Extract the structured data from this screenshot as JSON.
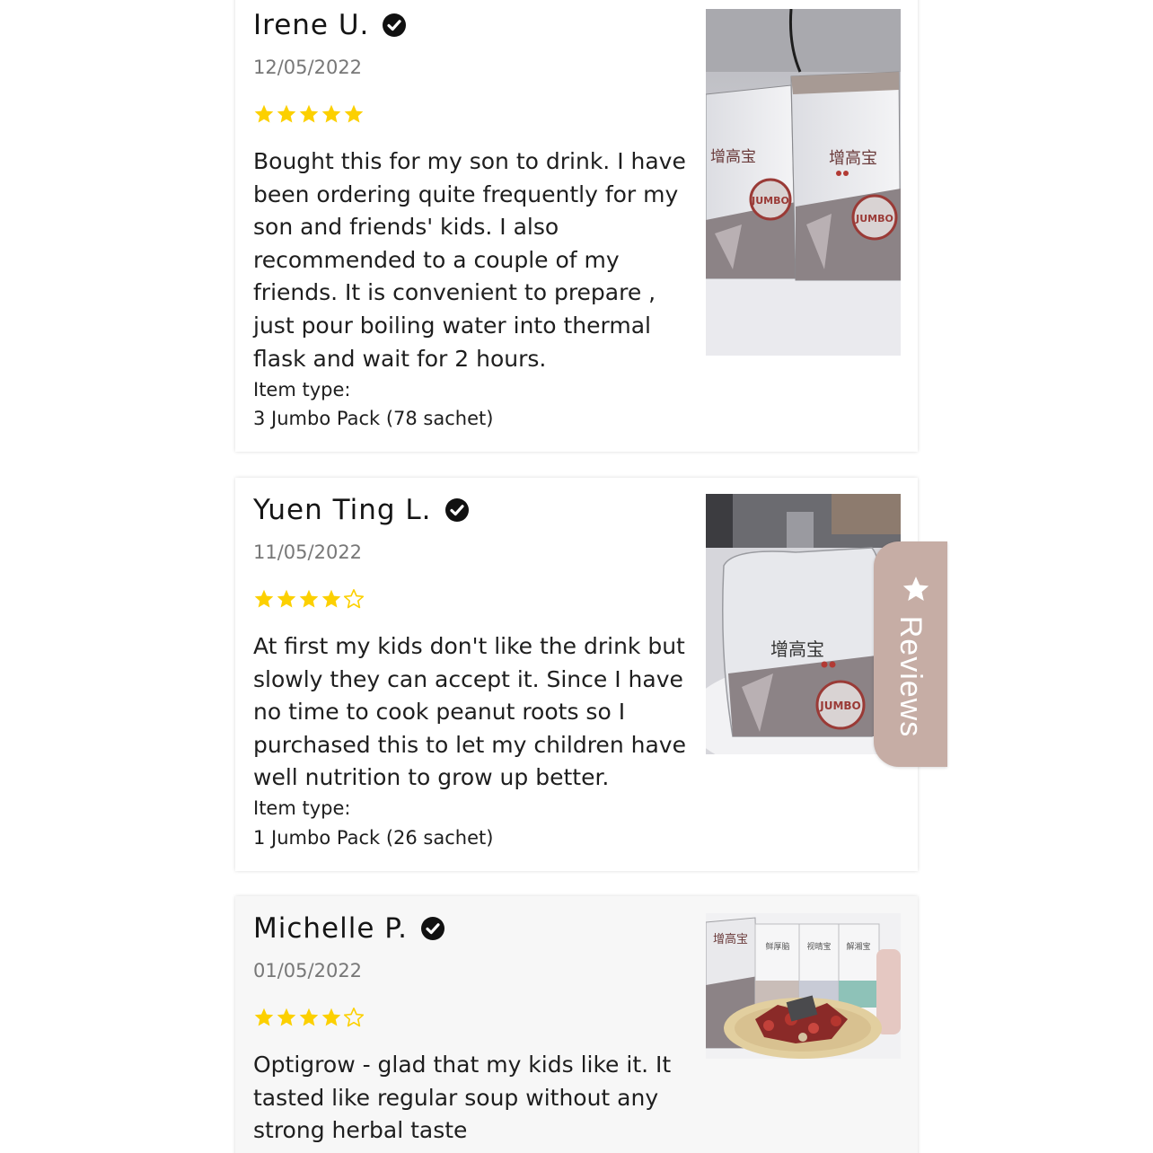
{
  "reviews": [
    {
      "name": "Irene U.",
      "date": "12/05/2022",
      "rating": 5,
      "text": "Bought this for my son to drink. I have been ordering quite frequently for my son and friends' kids. I also recommended to a couple of my friends. It is convenient to prepare , just pour boiling water into thermal flask and wait for 2 hours.",
      "item_type_label": "Item type:",
      "item_type": "3 Jumbo Pack (78 sachet)",
      "photo": {
        "brand": "增高宝",
        "badge": "JUMBO"
      }
    },
    {
      "name": "Yuen Ting L.",
      "date": "11/05/2022",
      "rating": 4,
      "text": "At first my kids don't like the drink but slowly they can accept it. Since I have no time to cook peanut roots so I purchased this to let my children have well nutrition to grow up better.",
      "item_type_label": "Item type:",
      "item_type": "1 Jumbo Pack (26 sachet)",
      "photo": {
        "brand": "增高宝",
        "badge": "JUMBO"
      }
    },
    {
      "name": "Michelle P.",
      "date": "01/05/2022",
      "rating": 4,
      "text": "Optigrow - glad that my kids like it. It tasted like regular soup without any strong herbal taste",
      "photo": {
        "brand": "增高宝",
        "labels": [
          "鲜厚脑",
          "视晴宝",
          "解湘宝"
        ]
      }
    }
  ],
  "reviews_tab": {
    "label": "Reviews",
    "icon": "star-icon"
  },
  "colors": {
    "star_fill": "#fcd000",
    "tab_background": "#c6ada5",
    "text": "#1e1e1e",
    "date": "#777777"
  }
}
